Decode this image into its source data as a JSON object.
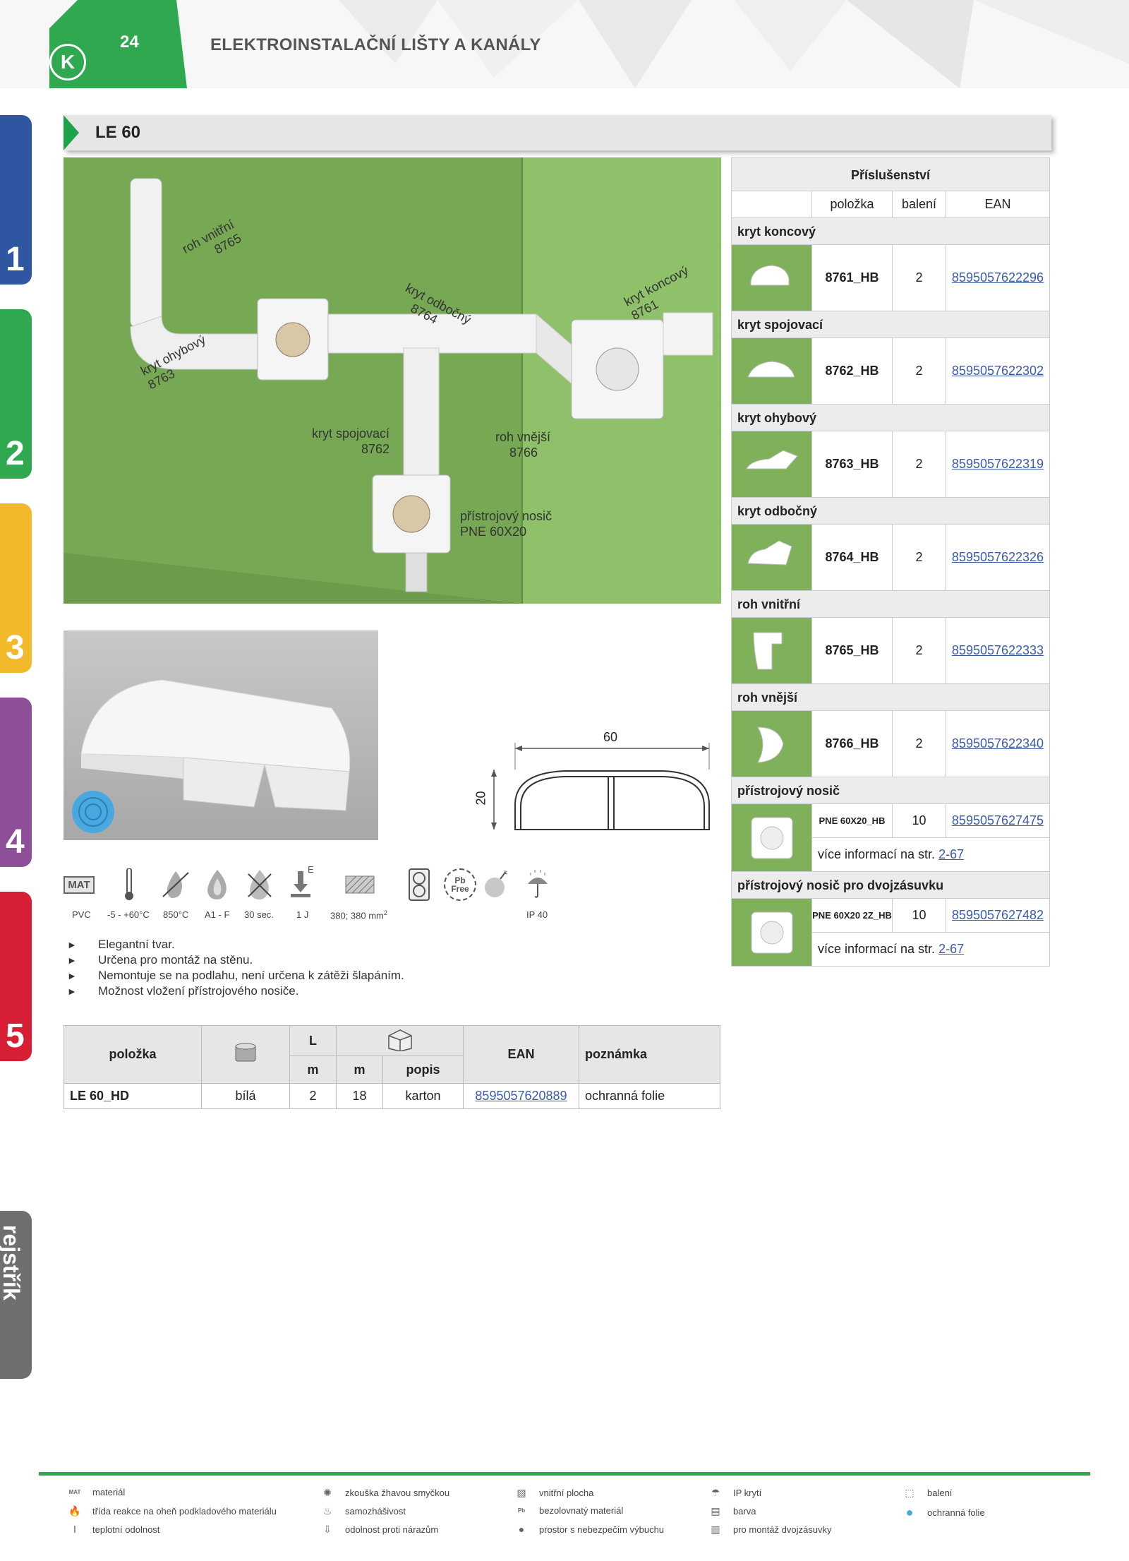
{
  "header": {
    "page_number": "24",
    "title": "ELEKTROINSTALAČNÍ LIŠTY A KANÁLY",
    "logo": "K"
  },
  "tabs": [
    {
      "label": "1",
      "color": "#2f56a0"
    },
    {
      "label": "2",
      "color": "#2fa84f"
    },
    {
      "label": "3",
      "color": "#f2b92b"
    },
    {
      "label": "4",
      "color": "#8c4f98"
    },
    {
      "label": "5",
      "color": "#d61f35"
    },
    {
      "label": "rejstřík",
      "color": "#6f6f6f"
    }
  ],
  "section": {
    "title": "LE 60"
  },
  "scene_labels": {
    "roh_vnitrni": [
      "roh vnitřní",
      "8765"
    ],
    "kryt_ohybovy": [
      "kryt ohybový",
      "8763"
    ],
    "kryt_odbocny": [
      "kryt odbočný",
      "8764"
    ],
    "kryt_koncovy": [
      "kryt koncový",
      "8761"
    ],
    "kryt_spojovaci": [
      "kryt spojovací",
      "8762"
    ],
    "roh_vnejsi": [
      "roh vnější",
      "8766"
    ],
    "pristrojovy_nosic": [
      "přístrojový nosič",
      "PNE 60X20"
    ]
  },
  "dimensions": {
    "width": "60",
    "height": "20"
  },
  "properties": [
    {
      "icon": "MAT",
      "label": "PVC"
    },
    {
      "icon": "thermometer-icon",
      "label": "-5 - +60°C"
    },
    {
      "icon": "glow-wire-icon",
      "label": "850°C"
    },
    {
      "icon": "flame-class-icon",
      "label": "A1 - F"
    },
    {
      "icon": "self-extinguish-icon",
      "label": "30 sec."
    },
    {
      "icon": "impact-icon",
      "label": "1 J"
    },
    {
      "icon": "inner-area-icon",
      "label": "380; 380 mm²"
    },
    {
      "icon": "double-socket-icon",
      "label": ""
    },
    {
      "icon": "pb-free-icon",
      "label": ""
    },
    {
      "icon": "explosion-icon",
      "label": ""
    },
    {
      "icon": "ip-icon",
      "label": "IP 40"
    }
  ],
  "impact_mark": "E",
  "pb_free": [
    "Pb",
    "Free"
  ],
  "bullets": [
    "Elegantní tvar.",
    "Určena pro montáž na stěnu.",
    "Nemontuje se na podlahu, není určena k zátěži šlapáním.",
    "Možnost vložení přístrojového nosiče."
  ],
  "main_table": {
    "headers": {
      "polozka": "položka",
      "L": "L",
      "ean": "EAN",
      "poznamka": "poznámka",
      "m1": "m",
      "m2": "m",
      "popis": "popis"
    },
    "row": {
      "polozka": "LE 60_HD",
      "barva": "bílá",
      "L": "2",
      "baleni": "18",
      "popis": "karton",
      "ean": "8595057620889",
      "poznamka": "ochranná folie"
    }
  },
  "accessories": {
    "title": "Příslušenství",
    "headers": {
      "polozka": "položka",
      "baleni": "balení",
      "ean": "EAN"
    },
    "groups": [
      {
        "name": "kryt koncový",
        "code": "8761_HB",
        "qty": "2",
        "ean": "8595057622296"
      },
      {
        "name": "kryt spojovací",
        "code": "8762_HB",
        "qty": "2",
        "ean": "8595057622302"
      },
      {
        "name": "kryt ohybový",
        "code": "8763_HB",
        "qty": "2",
        "ean": "8595057622319"
      },
      {
        "name": "kryt odbočný",
        "code": "8764_HB",
        "qty": "2",
        "ean": "8595057622326"
      },
      {
        "name": "roh vnitřní",
        "code": "8765_HB",
        "qty": "2",
        "ean": "8595057622333"
      },
      {
        "name": "roh vnější",
        "code": "8766_HB",
        "qty": "2",
        "ean": "8595057622340"
      }
    ],
    "nosic": [
      {
        "name": "přístrojový nosič",
        "code": "PNE 60X20_HB",
        "qty": "10",
        "ean": "8595057627475",
        "more": "více informací na str.",
        "page": "2-67"
      },
      {
        "name": "přístrojový nosič pro dvojzásuvku",
        "code": "PNE 60X20 2Z_HB",
        "qty": "10",
        "ean": "8595057627482",
        "more": "více informací na str.",
        "page": "2-67"
      }
    ]
  },
  "legend": [
    [
      "materiál",
      "třída reakce na oheň podkladového materiálu",
      "teplotní odolnost"
    ],
    [
      "zkouška žhavou smyčkou",
      "samozhášivost",
      "odolnost proti nárazům"
    ],
    [
      "vnitřní plocha",
      "bezolovnatý materiál",
      "prostor s nebezpečím výbuchu"
    ],
    [
      "IP krytí",
      "barva",
      "pro montáž dvojzásuvky"
    ],
    [
      "balení",
      "ochranná folie"
    ]
  ]
}
